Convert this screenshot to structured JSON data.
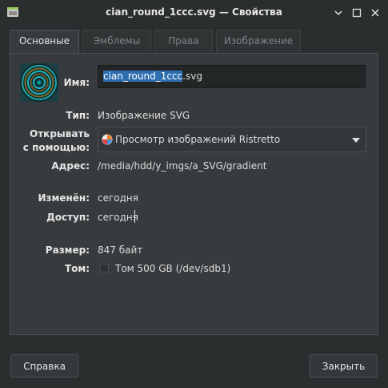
{
  "window": {
    "title": "cian_round_1ccc.svg — Свойства",
    "app_icon": "file-manager-icon",
    "controls": [
      "minimize-icon",
      "maximize-icon",
      "close-icon"
    ]
  },
  "tabs": [
    {
      "label": "Основные",
      "active": true
    },
    {
      "label": "Эмблемы",
      "active": false
    },
    {
      "label": "Права",
      "active": false
    },
    {
      "label": "Изображение",
      "active": false
    }
  ],
  "general": {
    "name_label": "Имя:",
    "name_selected": "cian_round_1ccc",
    "name_ext": ".svg",
    "type_label": "Тип:",
    "type_value": "Изображение SVG",
    "open_with_label_1": "Открывать",
    "open_with_label_2": "с помощью:",
    "open_with_value": "Просмотр изображений Ristretto",
    "open_with_icon": "ristretto-icon",
    "address_label": "Адрес:",
    "address_value": "/media/hdd/y_imgs/a_SVG/gradient",
    "modified_label": "Изменён:",
    "modified_value": "сегодня",
    "accessed_label": "Доступ:",
    "accessed_value": "сегодня",
    "size_label": "Размер:",
    "size_value": "847 байт",
    "volume_label": "Том:",
    "volume_value": "Том 500 GB (/dev/sdb1)"
  },
  "footer": {
    "help_label": "Справка",
    "close_label": "Закрыть"
  },
  "colors": {
    "window_bg": "#2b2e2f",
    "panel_bg": "#383b3d",
    "selection": "#2f6fb0"
  }
}
